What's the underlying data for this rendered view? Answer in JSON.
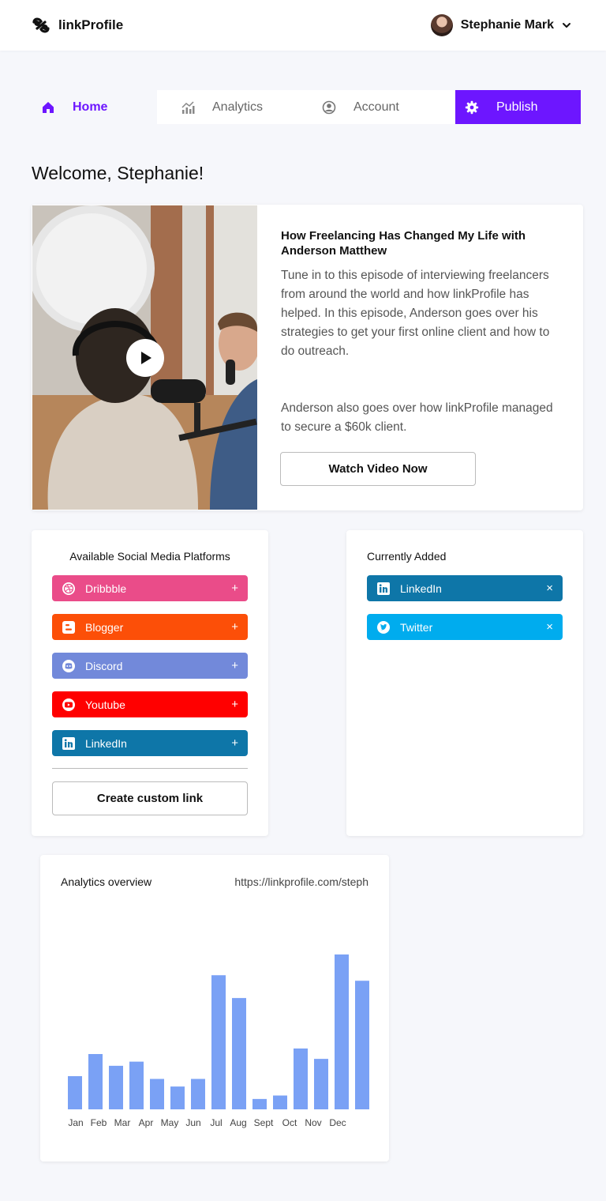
{
  "brand": {
    "name": "linkProfile"
  },
  "user": {
    "name": "Stephanie Mark"
  },
  "tabs": [
    {
      "label": "Home",
      "icon": "home-icon"
    },
    {
      "label": "Analytics",
      "icon": "analytics-icon"
    },
    {
      "label": "Account",
      "icon": "account-icon"
    },
    {
      "label": "Publish",
      "icon": "gear-icon"
    }
  ],
  "welcome": "Welcome, Stephanie!",
  "episode": {
    "title": "How Freelancing Has Changed My Life with Anderson Matthew",
    "description": "Tune in to this episode of interviewing freelancers from around the world and how linkProfile has helped. In this episode, Anderson goes over his strategies to get your first online client and how to do outreach.",
    "description_2": "Anderson also goes over how linkProfile managed to secure a $60k client.",
    "button": "Watch Video Now"
  },
  "available": {
    "title": "Available Social Media Platforms",
    "items": [
      {
        "label": "Dribbble",
        "color": "#ea4c89",
        "icon": "dribbble-icon",
        "action": "+"
      },
      {
        "label": "Blogger",
        "color": "#fc4f08",
        "icon": "blogger-icon",
        "action": "+"
      },
      {
        "label": "Discord",
        "color": "#7289da",
        "icon": "discord-icon",
        "action": "+"
      },
      {
        "label": "Youtube",
        "color": "#ff0000",
        "icon": "youtube-icon",
        "action": "+"
      },
      {
        "label": "LinkedIn",
        "color": "#0e76a8",
        "icon": "linkedin-icon",
        "action": "+"
      }
    ],
    "custom_button": "Create custom link"
  },
  "added": {
    "title": "Currently Added",
    "items": [
      {
        "label": "LinkedIn",
        "color": "#0e76a8",
        "icon": "linkedin-icon",
        "action": "×"
      },
      {
        "label": "Twitter",
        "color": "#00acee",
        "icon": "twitter-icon",
        "action": "×"
      }
    ]
  },
  "analytics": {
    "title": "Analytics overview",
    "url": "https://linkprofile.com/steph"
  },
  "chart_data": {
    "type": "bar",
    "categories": [
      "Jan",
      "Feb",
      "Mar",
      "Apr",
      "May",
      "Jun",
      "Jul",
      "Aug",
      "Sept",
      "Oct",
      "Nov",
      "Dec"
    ],
    "values": [
      48,
      80,
      63,
      69,
      44,
      33,
      44,
      194,
      161,
      15,
      20,
      88,
      73,
      224,
      186
    ],
    "bar_color": "#7aa1f5",
    "ylim": [
      0,
      240
    ],
    "grid": false
  }
}
